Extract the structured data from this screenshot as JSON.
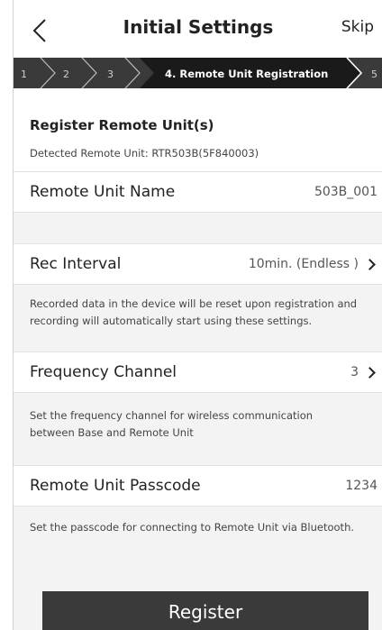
{
  "header": {
    "title": "Initial Settings",
    "skip_label": "Skip"
  },
  "steps": [
    {
      "label": "1",
      "active": false
    },
    {
      "label": "2",
      "active": false
    },
    {
      "label": "3",
      "active": false
    },
    {
      "label": "4. Remote Unit Registration",
      "active": true
    },
    {
      "label": "5",
      "active": false
    }
  ],
  "section": {
    "title": "Register Remote Unit(s)",
    "detected": "Detected Remote Unit: RTR503B(5F840003)"
  },
  "remote_unit_name": {
    "label": "Remote Unit Name",
    "value": "503B_001"
  },
  "rec_interval": {
    "label": "Rec Interval",
    "value": "10min. (Endless )",
    "note_line1": "Recorded data in the device will be reset upon registration and",
    "note_line2": "recording will automatically start using these settings."
  },
  "frequency_channel": {
    "label": "Frequency Channel",
    "value": "3",
    "note_line1": "Set the frequency channel for wireless communication",
    "note_line2": "between Base and Remote Unit"
  },
  "passcode": {
    "label": "Remote Unit Passcode",
    "value": "1234",
    "note_line1": "Set the passcode for connecting to Remote Unit via Bluetooth."
  },
  "register_label": "Register",
  "colors": {
    "step_bar": "#3a3a3a",
    "step_active": "#1a1a1a",
    "button": "#3a3a3a",
    "gray_bg": "#f3f3f3"
  }
}
